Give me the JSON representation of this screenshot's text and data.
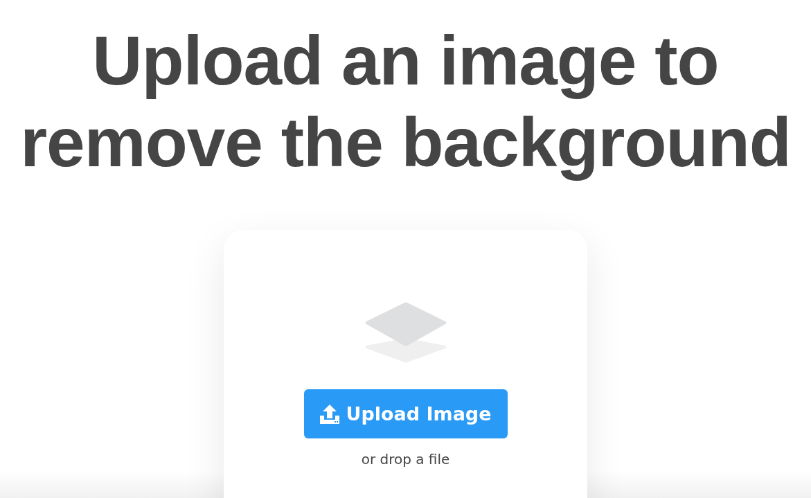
{
  "heading": "Upload an image to remove the background",
  "upload_button": {
    "label": "Upload Image"
  },
  "drop_hint": "or drop a file"
}
